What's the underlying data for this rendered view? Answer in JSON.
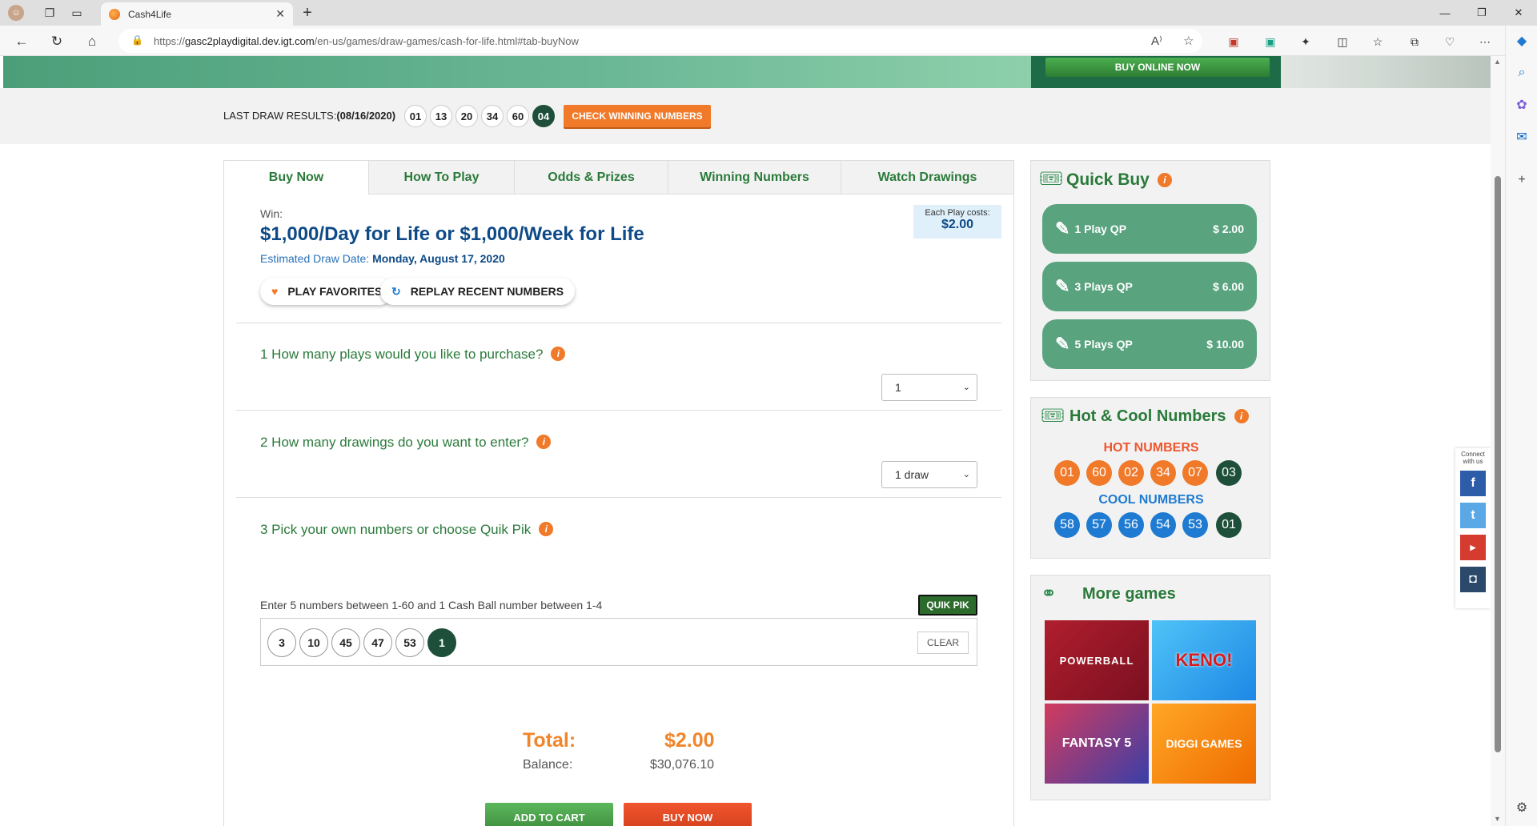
{
  "browser": {
    "tab_title": "Cash4Life",
    "url_prefix": "https://",
    "url_host": "gasc2playdigital.dev.igt.com",
    "url_path": "/en-us/games/draw-games/cash-for-life.html#tab-buyNow"
  },
  "hero": {
    "buy_online": "BUY ONLINE NOW"
  },
  "last_draw": {
    "label_prefix": "LAST DRAW RESULTS:",
    "date": "(08/16/2020)",
    "balls": [
      "01",
      "13",
      "20",
      "34",
      "60"
    ],
    "cash_ball": "04",
    "check_button": "CHECK WINNING NUMBERS"
  },
  "tabs": [
    "Buy Now",
    "How To Play",
    "Odds & Prizes",
    "Winning Numbers",
    "Watch Drawings"
  ],
  "buy": {
    "win_label": "Win:",
    "prize": "$1,000/Day for Life or $1,000/Week for Life",
    "draw_date_label": "Estimated Draw Date:",
    "draw_date": "Monday, August 17, 2020",
    "cost_label": "Each Play costs:",
    "cost": "$2.00",
    "play_favorites": "PLAY FAVORITES",
    "replay_recent": "REPLAY RECENT NUMBERS",
    "q1": "1 How many plays would you like to purchase?",
    "q1_value": "1",
    "q2": "2 How many drawings do you want to enter?",
    "q2_value": "1 draw",
    "q3": "3 Pick your own numbers or choose Quik Pik",
    "hint": "Enter 5 numbers between 1-60 and 1 Cash Ball number between 1-4",
    "quik_pik": "QUIK PIK",
    "picks": [
      "3",
      "10",
      "45",
      "47",
      "53"
    ],
    "cash_pick": "1",
    "clear": "CLEAR",
    "total_label": "Total:",
    "total": "$2.00",
    "balance_label": "Balance:",
    "balance": "$30,076.10",
    "add_to_cart": "ADD TO CART",
    "buy_now": "BUY NOW"
  },
  "quick_buy": {
    "title": "Quick Buy",
    "options": [
      {
        "label": "1 Play QP",
        "price": "$ 2.00"
      },
      {
        "label": "3 Plays QP",
        "price": "$ 6.00"
      },
      {
        "label": "5 Plays QP",
        "price": "$ 10.00"
      }
    ]
  },
  "hot_cool": {
    "title": "Hot & Cool Numbers",
    "hot_label": "HOT NUMBERS",
    "hot": [
      "01",
      "60",
      "02",
      "34",
      "07"
    ],
    "hot_cash": "03",
    "cool_label": "COOL NUMBERS",
    "cool": [
      "58",
      "57",
      "56",
      "54",
      "53"
    ],
    "cool_cash": "01"
  },
  "more_games": {
    "title": "More games",
    "games": [
      "POWERBALL",
      "KENO!",
      "FANTASY 5",
      "DIGGI GAMES"
    ]
  },
  "social": {
    "caption": "Connect with us"
  },
  "colors": {
    "green": "#2a7a3a",
    "orange": "#f07a2a",
    "navy": "#0e4a87",
    "dark_ball": "#1d4f3b"
  }
}
